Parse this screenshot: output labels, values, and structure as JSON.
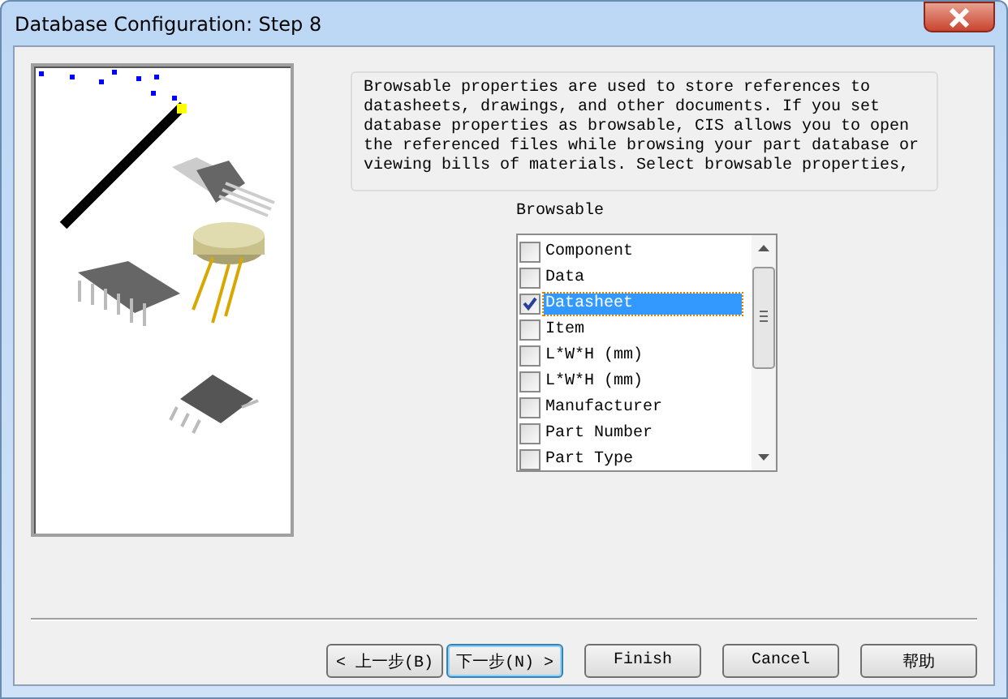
{
  "window": {
    "title": "Database Configuration: Step 8"
  },
  "description": "Browsable properties are used to store references to datasheets, drawings, and other documents. If you set database properties as browsable, CIS allows you to open the referenced files while browsing your part database or viewing bills of materials. Select browsable properties,",
  "browsable": {
    "label": "Browsable",
    "items": [
      {
        "label": "Component",
        "checked": false,
        "selected": false
      },
      {
        "label": "Data",
        "checked": false,
        "selected": false
      },
      {
        "label": "Datasheet",
        "checked": true,
        "selected": true
      },
      {
        "label": "Item",
        "checked": false,
        "selected": false
      },
      {
        "label": "L*W*H (mm)",
        "checked": false,
        "selected": false
      },
      {
        "label": "L*W*H (mm)",
        "checked": false,
        "selected": false
      },
      {
        "label": "Manufacturer",
        "checked": false,
        "selected": false
      },
      {
        "label": "Part Number",
        "checked": false,
        "selected": false
      },
      {
        "label": "Part Type",
        "checked": false,
        "selected": false
      }
    ]
  },
  "buttons": [
    {
      "label": "< 上一步(B)",
      "kind": "normal"
    },
    {
      "label": "下一步(N) >",
      "kind": "default"
    },
    {
      "label": "Finish",
      "kind": "normal"
    },
    {
      "label": "Cancel",
      "kind": "normal"
    },
    {
      "label": "帮助",
      "kind": "normal"
    }
  ]
}
